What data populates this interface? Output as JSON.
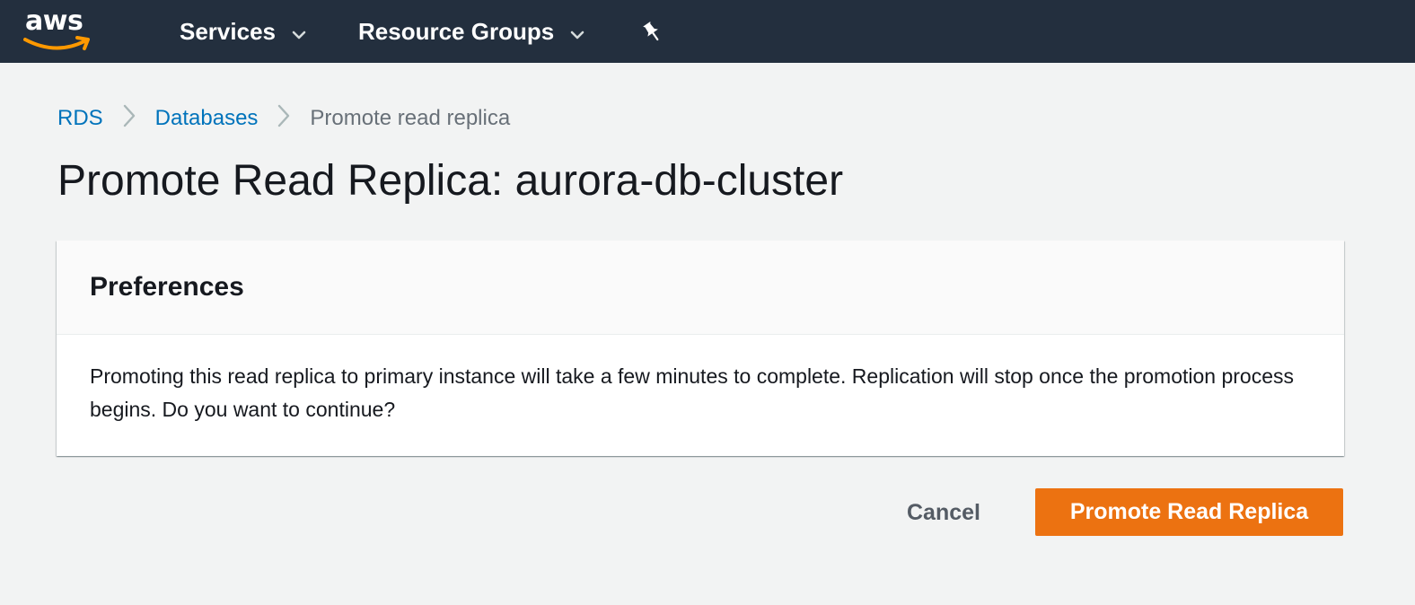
{
  "colors": {
    "nav_bg": "#232f3e",
    "logo_smile": "#ff9900",
    "link": "#0073bb",
    "primary_button": "#ec7211",
    "page_bg": "#f2f3f3"
  },
  "topnav": {
    "logo_text": "aws",
    "services_label": "Services",
    "resource_groups_label": "Resource Groups",
    "pin_icon": "pushpin-icon"
  },
  "breadcrumb": {
    "items": [
      "RDS",
      "Databases"
    ],
    "current": "Promote read replica",
    "separator_icon": "chevron-right-icon"
  },
  "page": {
    "title": "Promote Read Replica: aurora-db-cluster"
  },
  "preferences": {
    "title": "Preferences",
    "body": "Promoting this read replica to primary instance will take a few minutes to complete. Replication will stop once the promotion process begins. Do you want to continue?"
  },
  "actions": {
    "cancel_label": "Cancel",
    "primary_label": "Promote Read Replica"
  }
}
